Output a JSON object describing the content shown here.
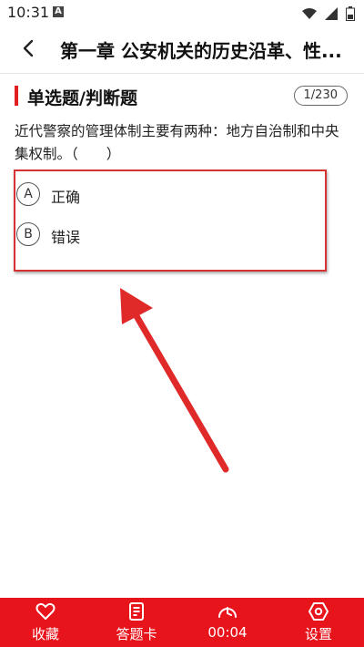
{
  "status_bar": {
    "time": "10:31",
    "notification_letter": "A"
  },
  "header": {
    "title": "第一章 公安机关的历史沿革、性..."
  },
  "question": {
    "type_label": "单选题/判断题",
    "counter": "1/230",
    "text": "近代警察的管理体制主要有两种：地方自治制和中央集权制。（　　）",
    "options": [
      {
        "letter": "A",
        "text": "正确"
      },
      {
        "letter": "B",
        "text": "错误"
      }
    ]
  },
  "bottom_nav": {
    "items": [
      {
        "label": "收藏",
        "icon": "heart-icon"
      },
      {
        "label": "答题卡",
        "icon": "answer-sheet-icon"
      },
      {
        "label": "00:04",
        "icon": "timer-icon"
      },
      {
        "label": "设置",
        "icon": "settings-icon"
      }
    ]
  },
  "colors": {
    "accent": "#e8141c",
    "annotation": "#e02a2a"
  }
}
